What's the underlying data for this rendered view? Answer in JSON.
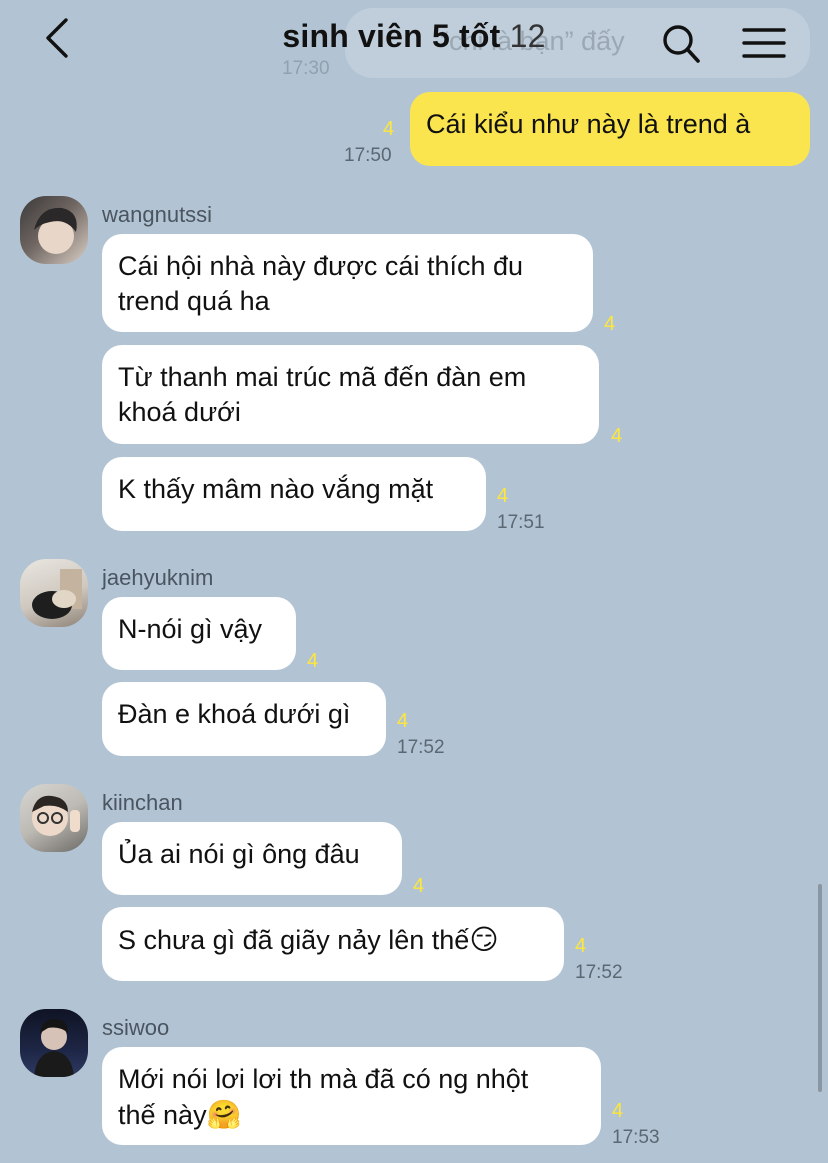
{
  "header": {
    "title": "sinh viên 5 tốt",
    "member_count": "12",
    "ghost_message": "“chỉ là bạn” đấy",
    "ghost_time": "17:30"
  },
  "messages": {
    "m1": {
      "text": "Cái kiểu như này là trend à",
      "unread": "4",
      "time": "17:50"
    },
    "g1": {
      "sender": "wangnutssi",
      "b1": {
        "line1": "Cái hội nhà này được cái thích đu",
        "line2": "trend quá ha",
        "unread": "4"
      },
      "b2": {
        "line1": "Từ thanh mai trúc mã đến đàn em",
        "line2": "khoá dưới",
        "unread": "4"
      },
      "b3": {
        "text": "K thấy mâm nào vắng mặt",
        "unread": "4",
        "time": "17:51"
      }
    },
    "g2": {
      "sender": "jaehyuknim",
      "b1": {
        "text": "N-nói gì vậy",
        "unread": "4"
      },
      "b2": {
        "text": "Đàn e khoá dưới gì",
        "unread": "4",
        "time": "17:52"
      }
    },
    "g3": {
      "sender": "kiinchan",
      "b1": {
        "text": "Ủa ai nói gì ông đâu",
        "unread": "4"
      },
      "b2": {
        "text": "S chưa gì đã giãy nảy lên thế",
        "emoji": "😏",
        "unread": "4",
        "time": "17:52"
      }
    },
    "g4": {
      "sender": "ssiwoo",
      "b1": {
        "line1": "Mới nói lơi lơi th mà đã có ng nhột",
        "line2": "thế này",
        "emoji": "🤗",
        "unread": "4",
        "time": "17:53"
      }
    }
  },
  "colors": {
    "background": "#b2c4d3",
    "my_bubble": "#fae54e",
    "other_bubble": "#ffffff",
    "unread_count": "#ffe63a"
  },
  "icons": [
    "back-arrow-icon",
    "search-icon",
    "menu-icon"
  ]
}
